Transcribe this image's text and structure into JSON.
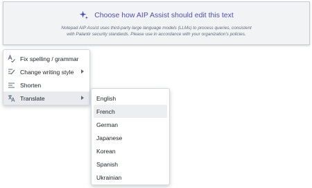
{
  "aip": {
    "title": "Choose how AIP Assist should edit this text",
    "disclaimer_line1": "Notepad AIP Assist uses third-party large language models (LLMs) to process queries, consistent",
    "disclaimer_line2": "with Palantir security standards. Please use in accordance with your organization's policies.",
    "icon": "sparkle-icon",
    "accent_color": "#4c4fb8"
  },
  "menu": {
    "items": [
      {
        "label": "Fix spelling / grammar",
        "icon": "spellcheck-icon"
      },
      {
        "label": "Change writing style",
        "icon": "style-icon",
        "submenu": true
      },
      {
        "label": "Shorten",
        "icon": "shorten-icon"
      },
      {
        "label": "Translate",
        "icon": "translate-icon",
        "submenu": true,
        "active": true
      }
    ]
  },
  "translate_menu": {
    "languages": [
      "English",
      "French",
      "German",
      "Japanese",
      "Korean",
      "Spanish",
      "Ukrainian"
    ],
    "highlighted": "French"
  }
}
